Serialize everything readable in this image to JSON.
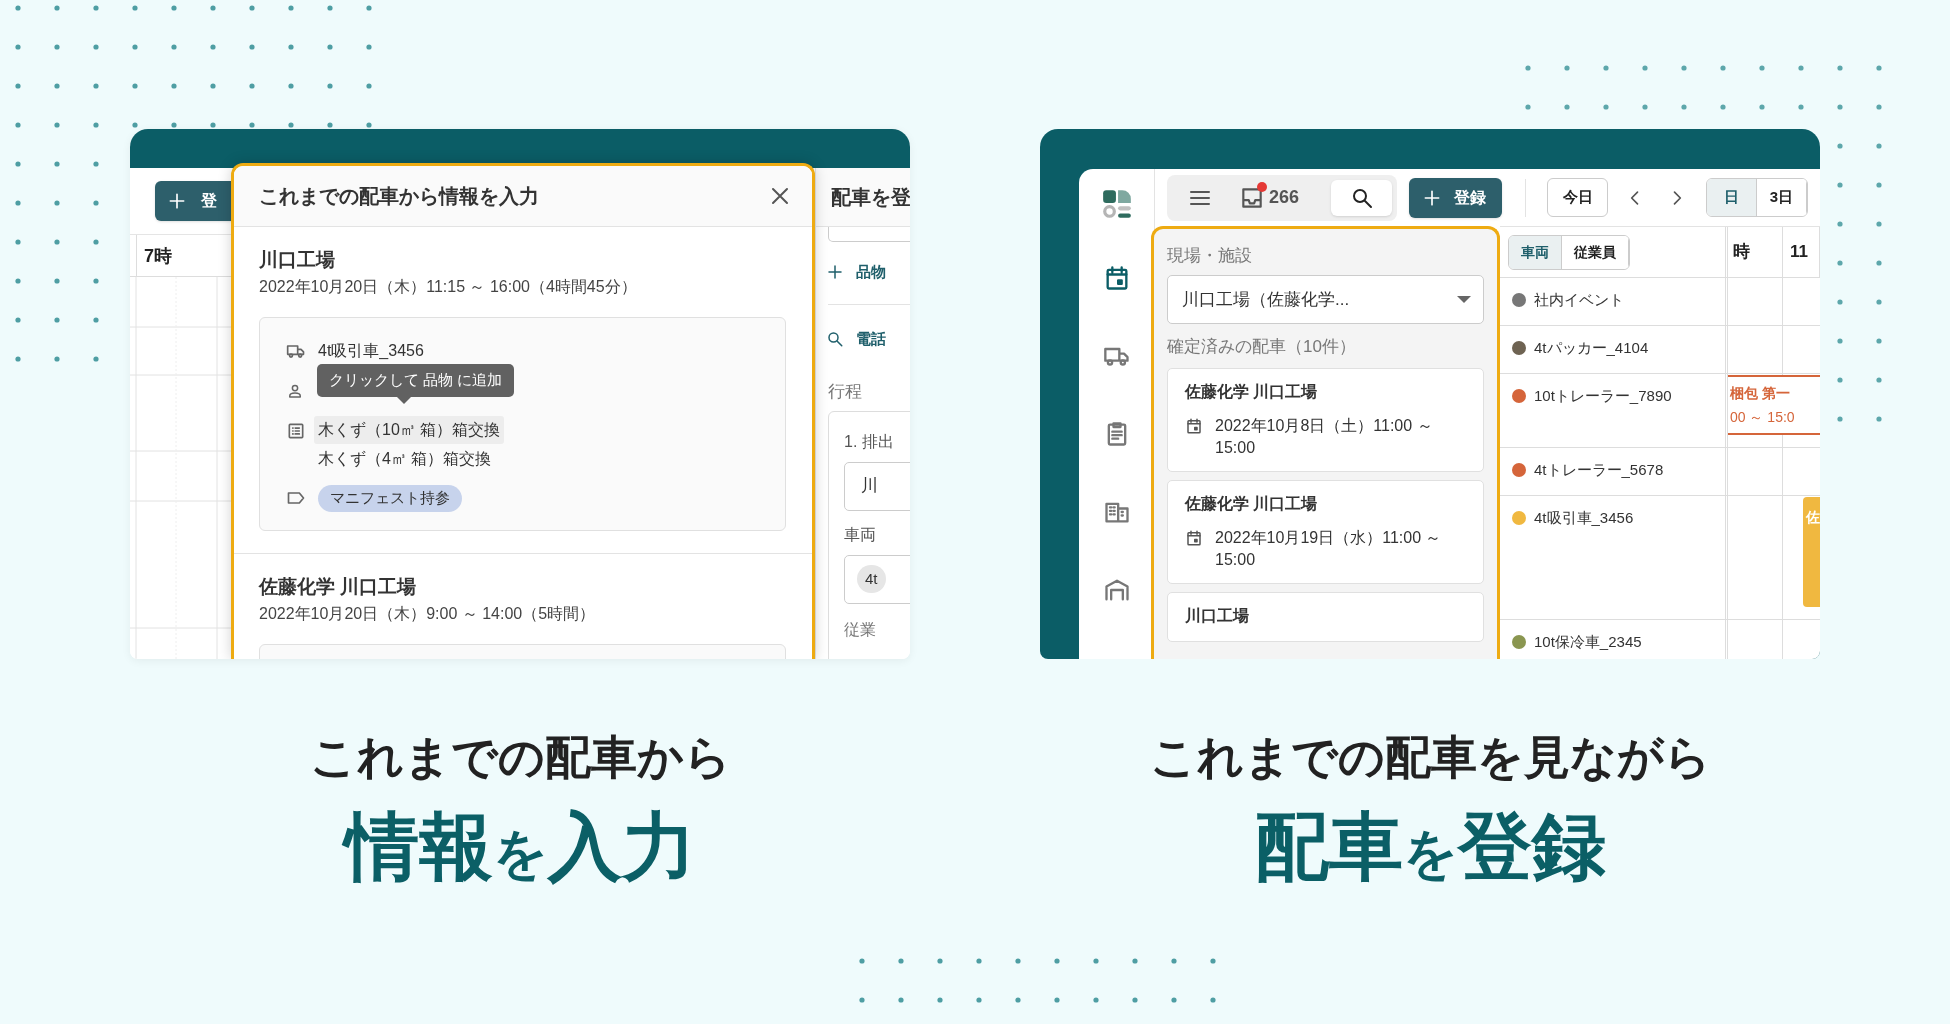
{
  "left_feature": {
    "app": {
      "register_button": "登",
      "hours": [
        "7時"
      ],
      "history_dialog": {
        "title": "これまでの配車から情報を入力",
        "records": [
          {
            "title": "川口工場",
            "time": "2022年10月20日（木）11:15 ～ 16:00（4時間45分）",
            "vehicle": "4t吸引車_3456",
            "items": [
              {
                "label": "木くず（10㎥ 箱）箱交換",
                "hovered": true
              },
              {
                "label": "木くず（4㎥ 箱）箱交換",
                "hovered": false
              }
            ],
            "tags": [
              "マニフェスト持参"
            ],
            "tooltip": "クリックして 品物 に追加"
          },
          {
            "title": "佐藤化学 川口工場",
            "time": "2022年10月20日（木）9:00 ～ 14:00（5時間）"
          }
        ]
      },
      "form_panel": {
        "title": "配車を登",
        "add_item": "品物",
        "search": "電話",
        "route_label": "行程",
        "stop_label": "1. 排出",
        "stop_value": "川",
        "vehicle_label": "車両",
        "vehicle_chip": "4t",
        "employee_label": "従業"
      }
    },
    "caption": {
      "line_1": "これまでの配車から",
      "line_2": [
        {
          "text": "情報",
          "large": true
        },
        {
          "text": "を",
          "large": false
        },
        {
          "text": "入力",
          "large": true
        }
      ]
    }
  },
  "right_feature": {
    "app": {
      "sidebar": [
        {
          "kind": "calendar",
          "selected": true
        },
        {
          "kind": "truck",
          "selected": false
        },
        {
          "kind": "clipboard",
          "selected": false
        },
        {
          "kind": "building",
          "selected": false
        },
        {
          "kind": "warehouse",
          "selected": false
        }
      ],
      "toolbar": {
        "notification_count": "266",
        "register_button": "登録",
        "today_button": "今日",
        "view_options": [
          {
            "label": "日",
            "selected": true
          },
          {
            "label": "3日",
            "selected": false
          }
        ]
      },
      "history_panel": {
        "facility_label": "現場・施設",
        "facility_value": "川口工場（佐藤化学...",
        "list_heading": "確定済みの配車（10件）",
        "records": [
          {
            "title": "佐藤化学 川口工場",
            "time": "2022年10月8日（土）11:00 ～ 15:00"
          },
          {
            "title": "佐藤化学 川口工場",
            "time": "2022年10月19日（水）11:00 ～ 15:00"
          },
          {
            "title": "川口工場"
          }
        ]
      },
      "schedule": {
        "resource_tabs": [
          {
            "label": "車両",
            "selected": true
          },
          {
            "label": "従業員",
            "selected": false
          }
        ],
        "hours": [
          "時",
          "11"
        ],
        "resources": [
          {
            "name": "社内イベント",
            "color": "#777777"
          },
          {
            "name": "4tパッカー_4104",
            "color": "#6e6352"
          },
          {
            "name": "10tトレーラー_7890",
            "color": "#d5653a",
            "events": [
              {
                "kind": "outline",
                "title": "梱包 第一",
                "time": "00 ～ 15:0"
              }
            ]
          },
          {
            "name": "4tトレーラー_5678",
            "color": "#d5653a"
          },
          {
            "name": "4t吸引車_3456",
            "color": "#f0b840",
            "events": [
              {
                "kind": "filled",
                "title": "佐"
              }
            ]
          },
          {
            "name": "10t保冷車_2345",
            "color": "#8a9650"
          }
        ]
      }
    },
    "caption": {
      "line_1": "これまでの配車を見ながら",
      "line_2": [
        {
          "text": "配車",
          "large": true
        },
        {
          "text": "を",
          "large": false
        },
        {
          "text": "登録",
          "large": true
        }
      ]
    }
  }
}
